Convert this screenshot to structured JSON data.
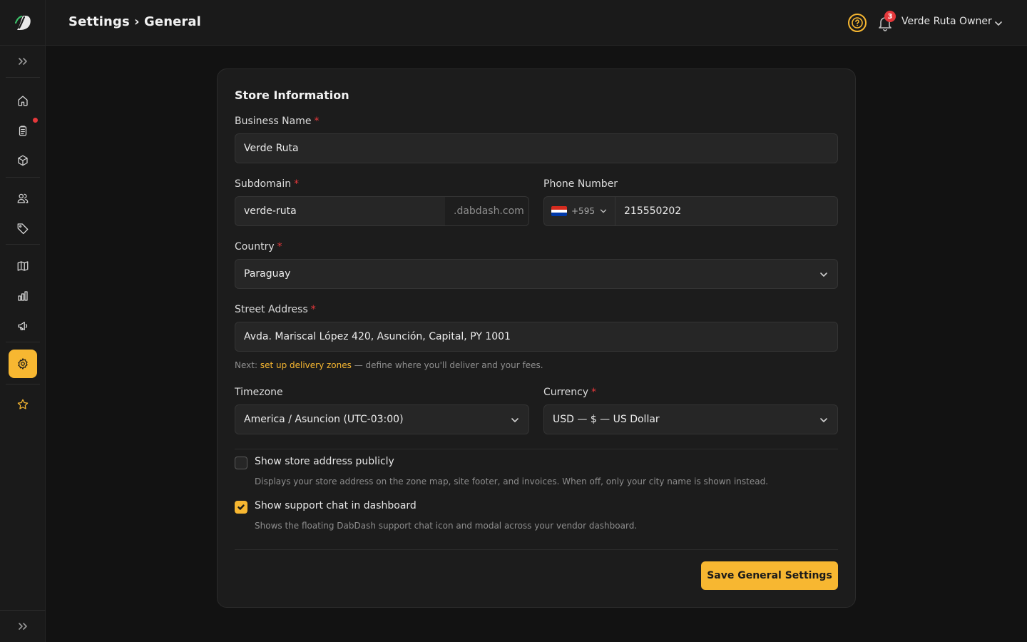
{
  "colors": {
    "accent": "#f7b731",
    "alert": "#e5383b",
    "background": "#121212",
    "surface": "#1c1c1c"
  },
  "header": {
    "breadcrumb": "Settings › General",
    "notifications_count": "3",
    "user_name": "Verde Ruta Owner",
    "icons": [
      "help-icon",
      "bell-icon",
      "chevron-down-icon"
    ]
  },
  "sidebar": {
    "items": [
      {
        "name": "home",
        "icon": "home-icon",
        "active": false
      },
      {
        "name": "orders",
        "icon": "clipboard-icon",
        "active": false,
        "has_dot": true
      },
      {
        "name": "products",
        "icon": "box-icon",
        "active": false
      },
      {
        "name": "customers",
        "icon": "users-icon",
        "active": false
      },
      {
        "name": "discounts",
        "icon": "tag-icon",
        "active": false
      },
      {
        "name": "zones",
        "icon": "map-icon",
        "active": false
      },
      {
        "name": "analytics",
        "icon": "bar-chart-icon",
        "active": false
      },
      {
        "name": "marketing",
        "icon": "megaphone-icon",
        "active": false
      },
      {
        "name": "settings",
        "icon": "gear-icon",
        "active": true
      },
      {
        "name": "favorites",
        "icon": "star-icon",
        "active": false
      }
    ]
  },
  "form": {
    "section_title": "Store Information",
    "business_name": {
      "label": "Business Name",
      "required": "*",
      "value": "Verde Ruta"
    },
    "subdomain": {
      "label": "Subdomain",
      "required": "*",
      "value": "verde-ruta",
      "suffix": ".dabdash.com"
    },
    "phone": {
      "label": "Phone Number",
      "country_code": "+595",
      "value": "215550202",
      "flag": "paraguay-flag"
    },
    "country": {
      "label": "Country",
      "required": "*",
      "value": "Paraguay"
    },
    "street": {
      "label": "Street Address",
      "required": "*",
      "value": "Avda. Mariscal López 420, Asunción, Capital, PY 1001"
    },
    "hint": {
      "prefix": "Next: ",
      "link": "set up delivery zones",
      "suffix": " — define where you'll deliver and your fees."
    },
    "timezone": {
      "label": "Timezone",
      "value": "America / Asuncion (UTC-03:00)"
    },
    "currency": {
      "label": "Currency",
      "required": "*",
      "value": "USD — $ — US Dollar"
    },
    "show_address": {
      "label": "Show store address publicly",
      "checked": false,
      "description": "Displays your store address on the zone map, site footer, and invoices. When off, only your city name is shown instead."
    },
    "show_chat": {
      "label": "Show support chat in dashboard",
      "checked": true,
      "description": "Shows the floating DabDash support chat icon and modal across your vendor dashboard."
    },
    "save_label": "Save General Settings"
  }
}
